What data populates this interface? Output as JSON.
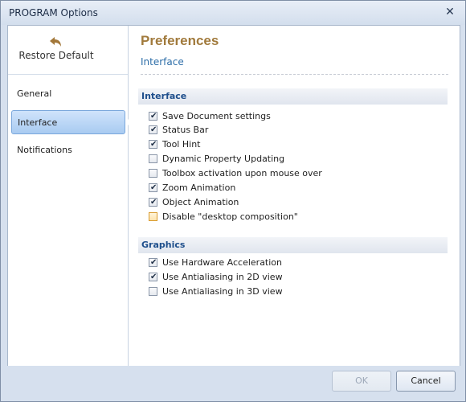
{
  "window": {
    "title": "PROGRAM Options",
    "close_glyph": "✕"
  },
  "sidebar": {
    "restore_label": "Restore Default",
    "items": [
      {
        "label": "General",
        "active": false
      },
      {
        "label": "Interface",
        "active": true
      },
      {
        "label": "Notifications",
        "active": false
      }
    ]
  },
  "content": {
    "title": "Preferences",
    "subtitle": "Interface",
    "sections": [
      {
        "header": "Interface",
        "options": [
          {
            "label": "Save Document settings",
            "checked": true
          },
          {
            "label": "Status Bar",
            "checked": true
          },
          {
            "label": "Tool Hint",
            "checked": true
          },
          {
            "label": "Dynamic Property Updating",
            "checked": false
          },
          {
            "label": "Toolbox activation upon mouse over",
            "checked": false
          },
          {
            "label": "Zoom Animation",
            "checked": true
          },
          {
            "label": "Object Animation",
            "checked": true
          },
          {
            "label": "Disable \"desktop composition\"",
            "checked": false,
            "highlighted": true
          }
        ]
      },
      {
        "header": "Graphics",
        "options": [
          {
            "label": "Use Hardware Acceleration",
            "checked": true
          },
          {
            "label": "Use Antialiasing in 2D view",
            "checked": true
          },
          {
            "label": "Use Antialiasing in 3D view",
            "checked": false
          }
        ]
      }
    ]
  },
  "footer": {
    "ok_label": "OK",
    "cancel_label": "Cancel"
  },
  "colors": {
    "accent": "#a17a3c",
    "subtitle": "#2d6ea8",
    "section": "#1f4f8c"
  }
}
